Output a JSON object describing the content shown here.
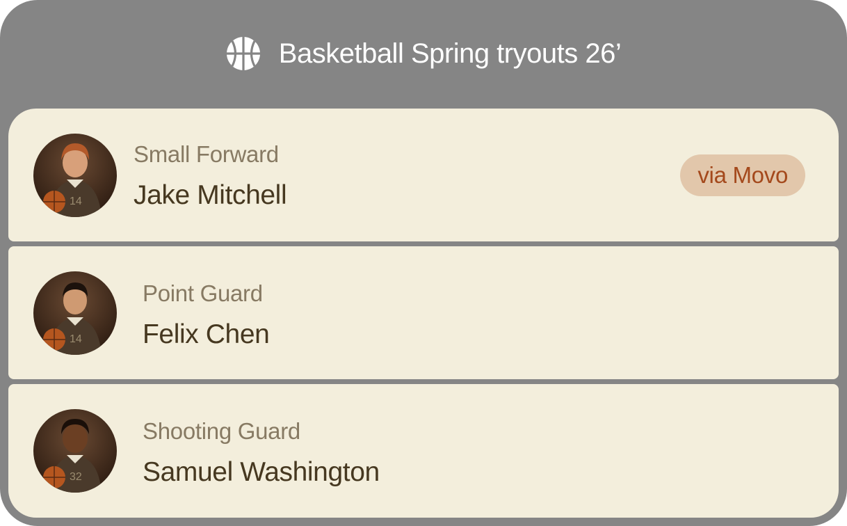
{
  "header": {
    "title": "Basketball Spring tryouts 26’",
    "icon": "basketball-icon"
  },
  "players": [
    {
      "role": "Small Forward",
      "name": "Jake Mitchell",
      "badge": "via Movo",
      "avatar": "portrait-red-hair"
    },
    {
      "role": "Point Guard",
      "name": "Felix Chen",
      "avatar": "portrait-black-hair"
    },
    {
      "role": "Shooting Guard",
      "name": "Samuel Washington",
      "avatar": "portrait-curly-hair"
    }
  ],
  "colors": {
    "panel_bg": "#858585",
    "card_bg": "#f3eedc",
    "role_text": "#877a63",
    "name_text": "#463820",
    "badge_bg": "#e2c7ab",
    "badge_text": "#a4491c"
  }
}
